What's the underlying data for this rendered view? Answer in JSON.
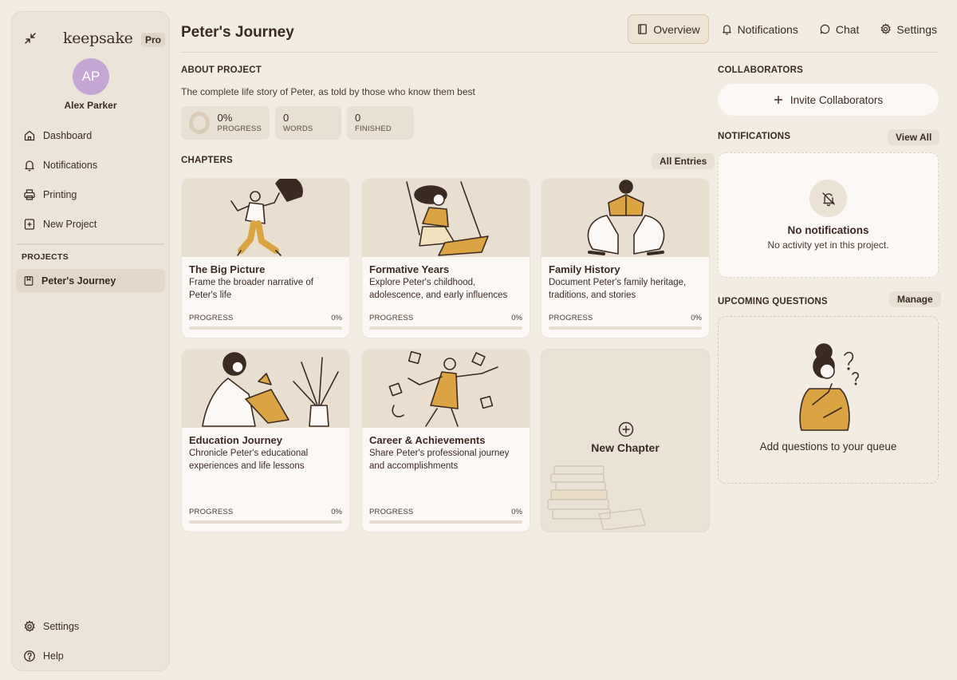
{
  "app": {
    "logo": "keepsake",
    "badge": "Pro"
  },
  "user": {
    "initials": "AP",
    "name": "Alex Parker"
  },
  "sidebar": {
    "nav": [
      {
        "label": "Dashboard",
        "icon": "home-icon"
      },
      {
        "label": "Notifications",
        "icon": "bell-icon"
      },
      {
        "label": "Printing",
        "icon": "printer-icon"
      },
      {
        "label": "New Project",
        "icon": "plus-square-icon"
      }
    ],
    "projects_label": "PROJECTS",
    "projects": [
      {
        "label": "Peter's Journey",
        "icon": "book-icon"
      }
    ],
    "bottom": [
      {
        "label": "Settings",
        "icon": "gear-icon"
      },
      {
        "label": "Help",
        "icon": "help-icon"
      }
    ]
  },
  "header": {
    "title": "Peter's Journey",
    "tabs": [
      {
        "label": "Overview",
        "icon": "book-icon",
        "active": true
      },
      {
        "label": "Notifications",
        "icon": "bell-icon"
      },
      {
        "label": "Chat",
        "icon": "chat-icon"
      },
      {
        "label": "Settings",
        "icon": "gear-icon"
      }
    ]
  },
  "about": {
    "label": "ABOUT PROJECT",
    "description": "The complete life story of Peter, as told by those who know them best",
    "stats": [
      {
        "value": "0%",
        "label": "PROGRESS"
      },
      {
        "value": "0",
        "label": "WORDS"
      },
      {
        "value": "0",
        "label": "FINISHED"
      }
    ]
  },
  "chapters": {
    "label": "CHAPTERS",
    "all_entries": "All Entries",
    "progress_label": "PROGRESS",
    "items": [
      {
        "title": "The Big Picture",
        "description": "Frame the broader narrative of Peter's life",
        "progress": "0%",
        "progress_value": 0
      },
      {
        "title": "Formative Years",
        "description": "Explore Peter's childhood, adolescence, and early influences",
        "progress": "0%",
        "progress_value": 0
      },
      {
        "title": "Family History",
        "description": "Document Peter's family heritage, traditions, and stories",
        "progress": "0%",
        "progress_value": 0
      },
      {
        "title": "Education Journey",
        "description": "Chronicle Peter's educational experiences and life lessons",
        "progress": "0%",
        "progress_value": 0
      },
      {
        "title": "Career & Achievements",
        "description": "Share Peter's professional journey and accomplishments",
        "progress": "0%",
        "progress_value": 0
      }
    ],
    "new_chapter": "New Chapter"
  },
  "collaborators": {
    "label": "COLLABORATORS",
    "invite": "Invite Collaborators"
  },
  "notifications": {
    "label": "NOTIFICATIONS",
    "view_all": "View All",
    "empty_title": "No notifications",
    "empty_text": "No activity yet in this project."
  },
  "questions": {
    "label": "UPCOMING QUESTIONS",
    "manage": "Manage",
    "empty_text": "Add questions to your queue"
  },
  "colors": {
    "background": "#f2ece3",
    "accent": "#d9a441",
    "ink": "#3b2a22",
    "avatar": "#c4a5d6"
  }
}
